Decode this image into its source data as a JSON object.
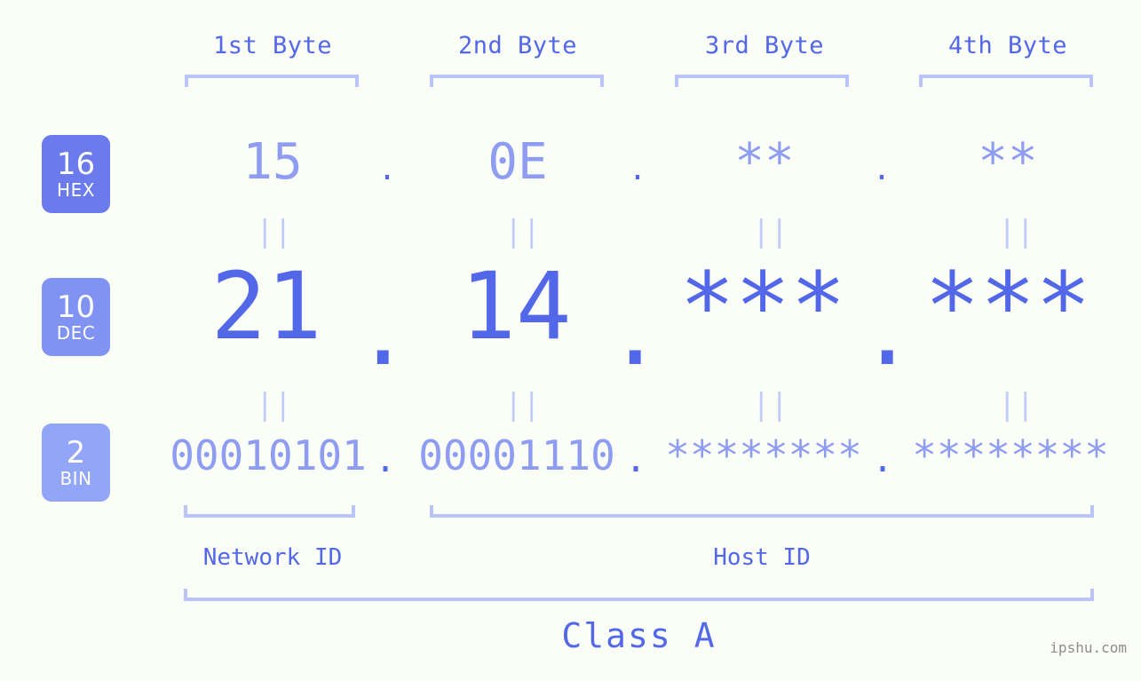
{
  "background_color": "#fbfdf7",
  "accent_strong": "#5268e8",
  "accent_light": "#8e9cf1",
  "accent_faint": "#c4cdf8",
  "bracket_color": "#b9c4f8",
  "byte_headers": [
    {
      "label": "1st Byte"
    },
    {
      "label": "2nd Byte"
    },
    {
      "label": "3rd Byte"
    },
    {
      "label": "4th Byte"
    }
  ],
  "bases": [
    {
      "number": "16",
      "abbr": "HEX",
      "color": "#6b7beb"
    },
    {
      "number": "10",
      "abbr": "DEC",
      "color": "#8093f2"
    },
    {
      "number": "2",
      "abbr": "BIN",
      "color": "#93a5f6"
    }
  ],
  "rows": {
    "hex": {
      "octets": [
        "15",
        "0E",
        "**",
        "**"
      ],
      "separator": "."
    },
    "dec": {
      "octets": [
        "21",
        "14",
        "***",
        "***"
      ],
      "separator": "."
    },
    "bin": {
      "octets": [
        "00010101",
        "00001110",
        "********",
        "********"
      ],
      "separator": "."
    }
  },
  "equals_symbol": "||",
  "id_labels": {
    "network": "Network ID",
    "host": "Host ID"
  },
  "class_label": "Class A",
  "watermark": "ipshu.com"
}
